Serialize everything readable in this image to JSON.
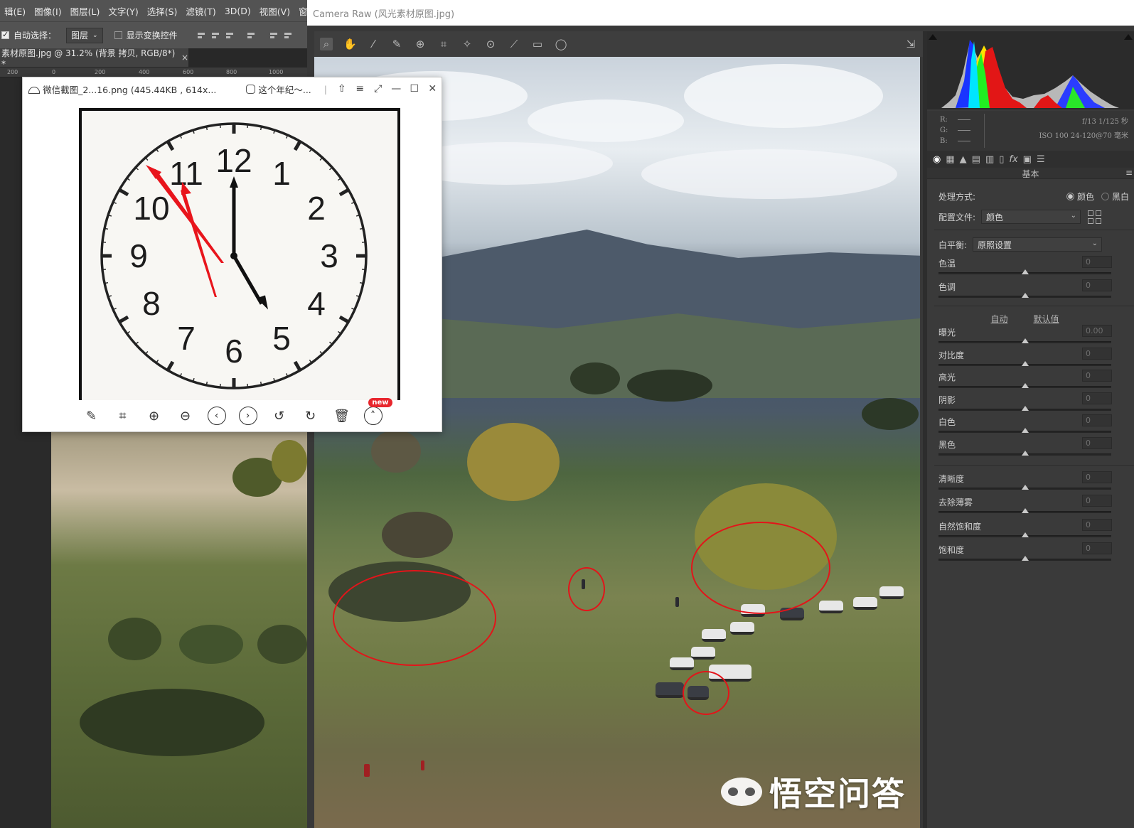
{
  "photoshop": {
    "menus": [
      "辑(E)",
      "图像(I)",
      "图层(L)",
      "文字(Y)",
      "选择(S)",
      "滤镜(T)",
      "3D(D)",
      "视图(V)",
      "窗口"
    ],
    "options": {
      "auto_select_label": "自动选择：",
      "auto_select_value": "图层",
      "show_transform_label": "显示变换控件"
    },
    "doc_tab": {
      "title": "素材原图.jpg @ 31.2% (背景 拷贝, RGB/8*) *",
      "close": "×"
    },
    "ruler_ticks": [
      "200",
      "0",
      "200",
      "400",
      "600",
      "800",
      "1000"
    ]
  },
  "camera_raw": {
    "title": "Camera Raw (风光素材原图.jpg)",
    "info": {
      "r_label": "R:",
      "g_label": "G:",
      "b_label": "B:",
      "exposure": "f/13   1/125 秒",
      "iso_lens": "ISO 100   24-120@70 毫米"
    },
    "panel": {
      "section_title": "基本",
      "treatment_label": "处理方式:",
      "treatment_color": "颜色",
      "treatment_bw": "黑白",
      "profile_label": "配置文件:",
      "profile_value": "颜色",
      "wb_label": "白平衡:",
      "wb_value": "原照设置",
      "auto_link": "自动",
      "default_link": "默认值",
      "sliders_wb": [
        {
          "label": "色温",
          "value": "0"
        },
        {
          "label": "色调",
          "value": "0"
        }
      ],
      "sliders_tone": [
        {
          "label": "曝光",
          "value": "0.00"
        },
        {
          "label": "对比度",
          "value": "0"
        },
        {
          "label": "高光",
          "value": "0"
        },
        {
          "label": "阴影",
          "value": "0"
        },
        {
          "label": "白色",
          "value": "0"
        },
        {
          "label": "黑色",
          "value": "0"
        }
      ],
      "sliders_presence": [
        {
          "label": "清晰度",
          "value": "0"
        },
        {
          "label": "去除薄雾",
          "value": "0"
        },
        {
          "label": "自然饱和度",
          "value": "0"
        },
        {
          "label": "饱和度",
          "value": "0"
        }
      ]
    }
  },
  "viewer": {
    "filename": "微信截图_2...16.png (445.44KB , 614x...",
    "source": "这个年纪～...",
    "new_badge": "new",
    "clock_numbers": [
      "12",
      "1",
      "2",
      "3",
      "4",
      "5",
      "6",
      "7",
      "8",
      "9",
      "10",
      "11"
    ]
  },
  "watermark": {
    "text": "悟空问答"
  },
  "colors": {
    "annotation_red": "#e3141a",
    "new_badge": "#e8262d"
  }
}
